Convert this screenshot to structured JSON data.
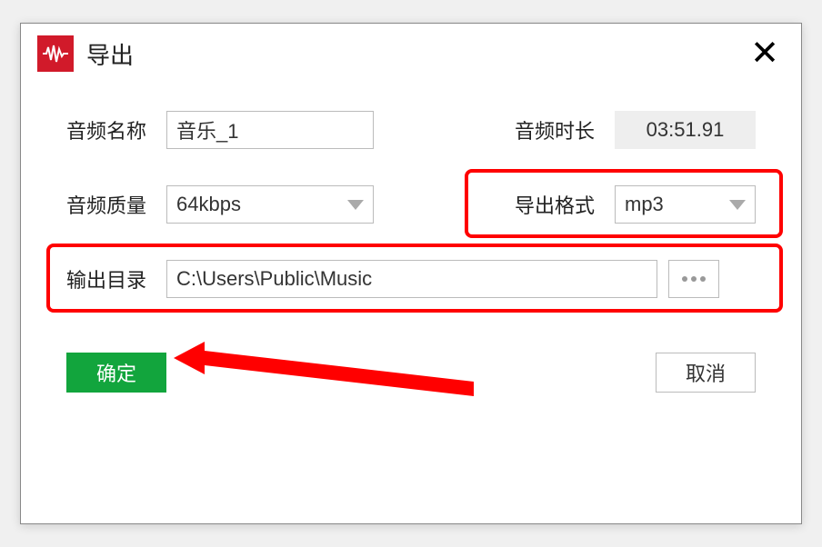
{
  "dialog": {
    "title": "导出",
    "fields": {
      "name_label": "音频名称",
      "name_value": "音乐_1",
      "duration_label": "音频时长",
      "duration_value": "03:51.91",
      "quality_label": "音频质量",
      "quality_value": "64kbps",
      "format_label": "导出格式",
      "format_value": "mp3",
      "output_label": "输出目录",
      "output_value": "C:\\Users\\Public\\Music"
    },
    "buttons": {
      "ok": "确定",
      "cancel": "取消"
    }
  }
}
